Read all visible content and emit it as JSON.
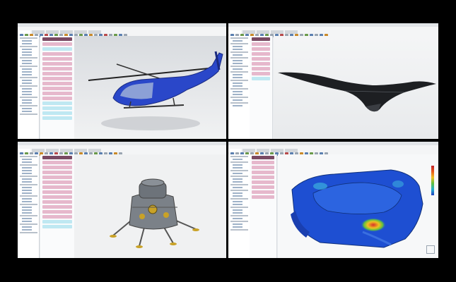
{
  "screen": {
    "description_label": "",
    "panes": [
      {
        "id": "helicopter",
        "model": "helicopter"
      },
      {
        "id": "wing",
        "model": "flying-wing"
      },
      {
        "id": "lander",
        "model": "lunar-lander"
      },
      {
        "id": "fea",
        "model": "fea-housing"
      }
    ]
  },
  "colors": {
    "helicopter_body": "#2a47c9",
    "wing_body": "#1d1f22",
    "lander_body": "#7b8188",
    "fea_base": "#1e4fd2",
    "fea_hot": "#d8302a",
    "step_pink": "#e6b8cc",
    "step_cyan": "#bfe8f2"
  }
}
